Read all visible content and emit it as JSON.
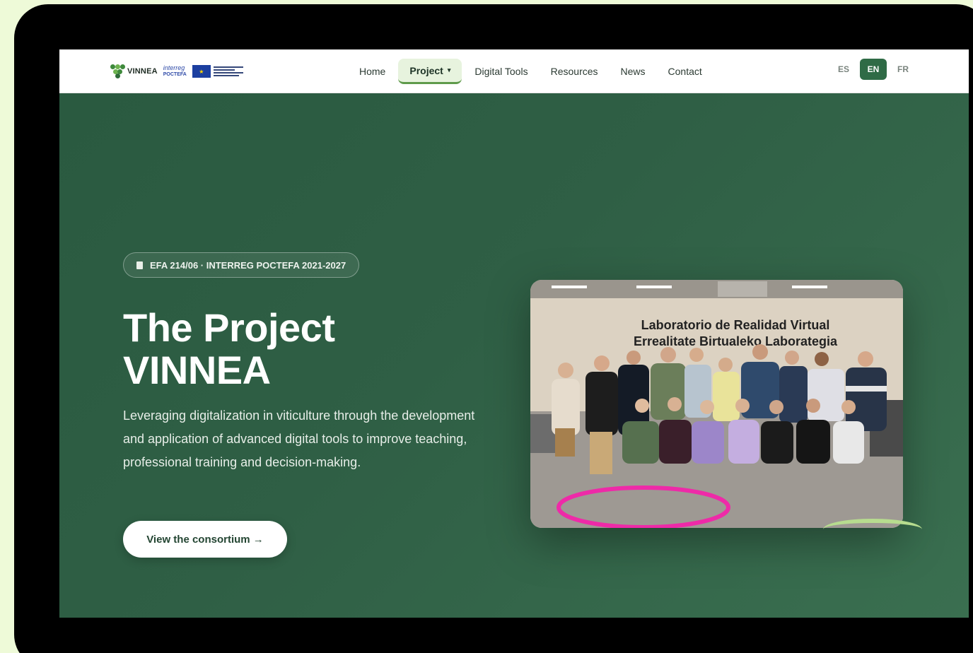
{
  "nav": {
    "brand": "VINNEA",
    "interreg_line1": "interreg",
    "interreg_line2": "POCTEFA",
    "menu": [
      {
        "label": "Home"
      },
      {
        "label": "Project",
        "active": true
      },
      {
        "label": "Digital Tools"
      },
      {
        "label": "Resources"
      },
      {
        "label": "News"
      },
      {
        "label": "Contact"
      }
    ],
    "languages": [
      {
        "label": "ES"
      },
      {
        "label": "EN",
        "active": true
      },
      {
        "label": "FR"
      }
    ]
  },
  "hero": {
    "badge": "EFA 214/06 · INTERREG POCTEFA 2021-2027",
    "title_line1": "The Project",
    "title_line2": "VINNEA",
    "description": "Leveraging digitalization in viticulture through the development and application of advanced digital tools to improve teaching, professional training and decision-making.",
    "cta_label": "View the consortium →",
    "photo": {
      "sign_line1": "Laboratorio de Realidad Virtual",
      "sign_line2": "Errealitate Birtualeko Laborategia"
    }
  },
  "colors": {
    "hero_bg": "#2f5d44",
    "accent": "#2f6b46",
    "active_tab_bg": "#e7f3de",
    "page_bg": "#eefad8"
  }
}
